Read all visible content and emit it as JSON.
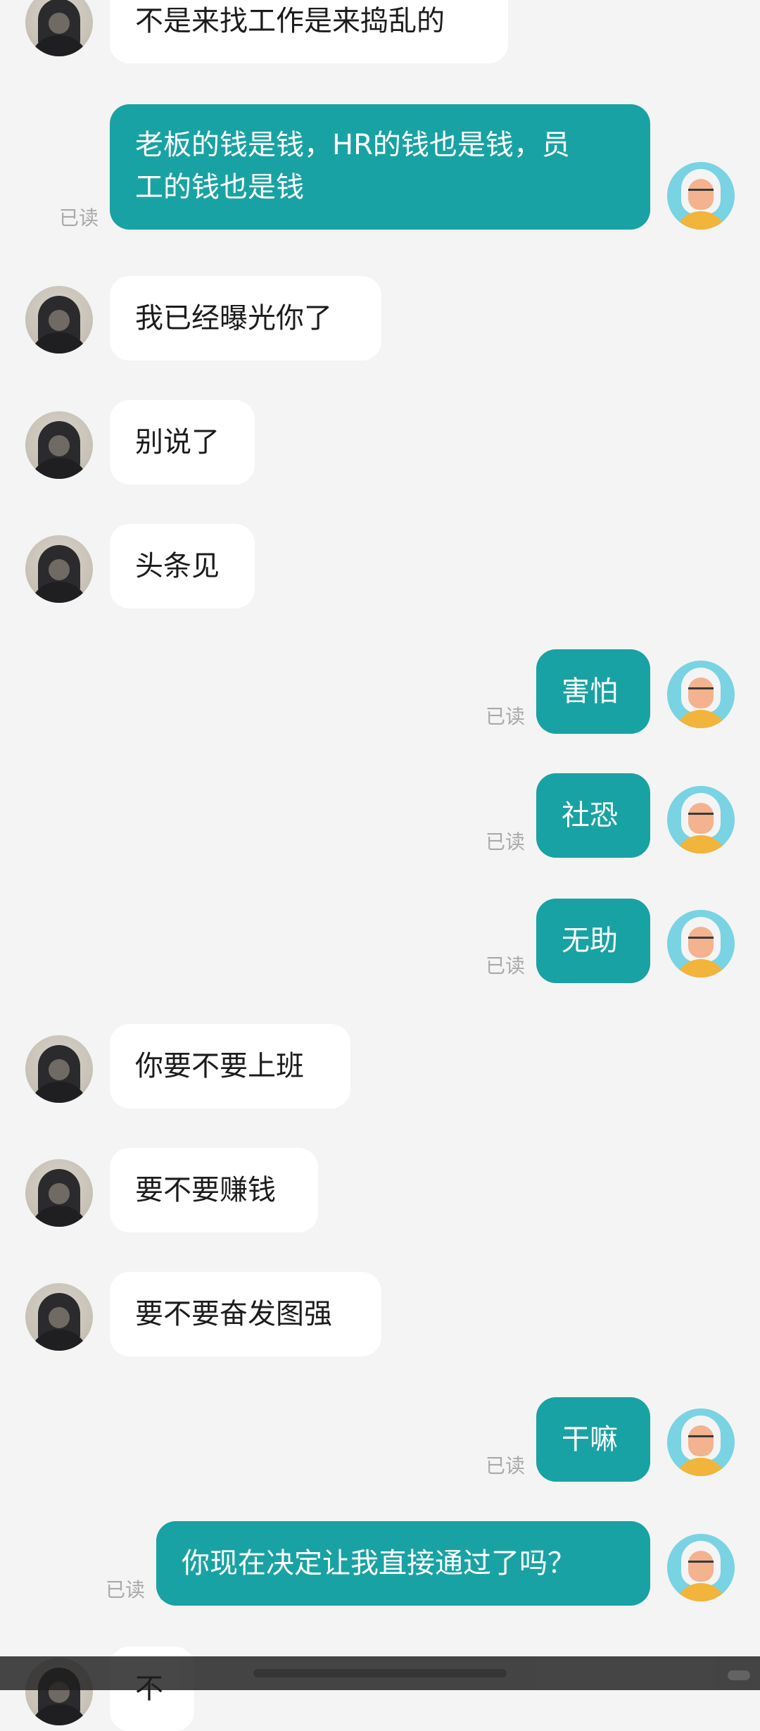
{
  "conversation": {
    "read_label": "已读",
    "messages": [
      {
        "side": "left",
        "text": "不是来找工作是来捣乱的"
      },
      {
        "side": "right",
        "line1": "老板的钱是钱，HR的钱也是钱，员",
        "line2": "工的钱也是钱"
      },
      {
        "side": "left",
        "text": "我已经曝光你了"
      },
      {
        "side": "left",
        "text": "别说了"
      },
      {
        "side": "left",
        "text": "头条见"
      },
      {
        "side": "right",
        "text": "害怕"
      },
      {
        "side": "right",
        "text": "社恐"
      },
      {
        "side": "right",
        "text": "无助"
      },
      {
        "side": "left",
        "text": "你要不要上班"
      },
      {
        "side": "left",
        "text": "要不要赚钱"
      },
      {
        "side": "left",
        "text": "要不要奋发图强"
      },
      {
        "side": "right",
        "text": "干嘛"
      },
      {
        "side": "right",
        "text": "你现在决定让我直接通过了吗？"
      },
      {
        "side": "left",
        "text": "不"
      }
    ]
  }
}
